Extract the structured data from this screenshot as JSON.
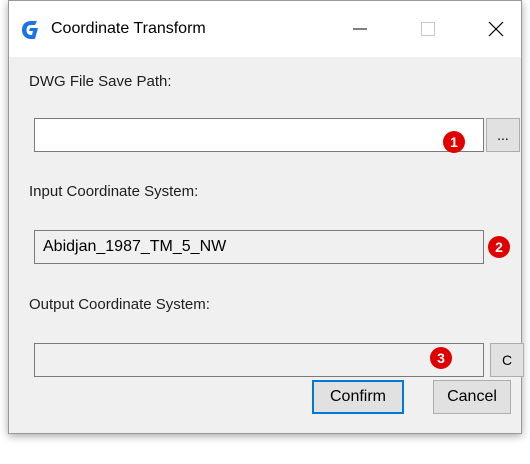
{
  "window": {
    "title": "Coordinate Transform",
    "icon": "g-logo-icon",
    "accent": "#1a73e8"
  },
  "dwg": {
    "label": "DWG File Save Path:",
    "value": "",
    "browse_label": "...",
    "badge": "1"
  },
  "input_cs": {
    "label": "Input Coordinate System:",
    "value": "Abidjan_1987_TM_5_NW",
    "badge": "2"
  },
  "output_cs": {
    "label": "Output Coordinate System:",
    "value": "",
    "choose_label": "C",
    "badge": "3"
  },
  "actions": {
    "confirm_label": "Confirm",
    "cancel_label": "Cancel"
  },
  "colors": {
    "badge": "#e00000",
    "default_button_border": "#0078d7"
  }
}
